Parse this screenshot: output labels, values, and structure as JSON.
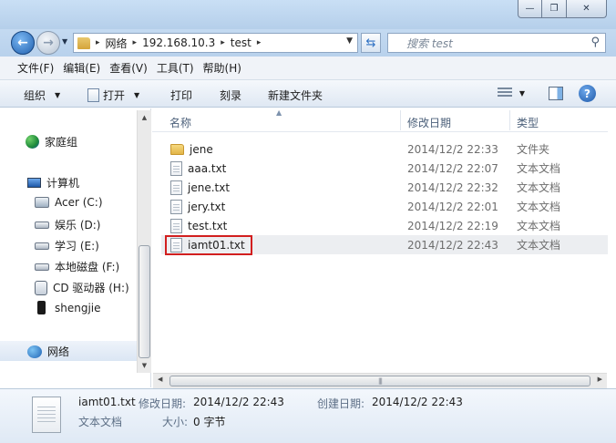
{
  "window": {
    "minimize_glyph": "—",
    "maximize_glyph": "❐",
    "close_glyph": "✕"
  },
  "address": {
    "segments": [
      "网络",
      "192.168.10.3",
      "test"
    ],
    "separator": "▸",
    "search_placeholder": "搜索 test"
  },
  "menu": [
    "文件(F)",
    "编辑(E)",
    "查看(V)",
    "工具(T)",
    "帮助(H)"
  ],
  "toolbar": {
    "organize": "组织",
    "open": "打开",
    "print": "打印",
    "burn": "刻录",
    "new_folder": "新建文件夹"
  },
  "nav": {
    "homegroup": "家庭组",
    "computer": "计算机",
    "drives": [
      {
        "label": "Acer (C:)",
        "icon": "windows-drive-icon"
      },
      {
        "label": "娱乐 (D:)",
        "icon": "drive-icon"
      },
      {
        "label": "学习 (E:)",
        "icon": "drive-icon"
      },
      {
        "label": "本地磁盘 (F:)",
        "icon": "drive-icon"
      },
      {
        "label": "CD 驱动器 (H:)",
        "icon": "cd-drive-icon"
      },
      {
        "label": "shengjie",
        "icon": "phone-icon"
      }
    ],
    "network": "网络"
  },
  "columns": {
    "name": "名称",
    "modified": "修改日期",
    "type": "类型"
  },
  "files": [
    {
      "name": "jene",
      "date": "2014/12/2 22:33",
      "type": "文件夹",
      "icon": "folder-icon"
    },
    {
      "name": "aaa.txt",
      "date": "2014/12/2 22:07",
      "type": "文本文档",
      "icon": "text-file-icon"
    },
    {
      "name": "jene.txt",
      "date": "2014/12/2 22:32",
      "type": "文本文档",
      "icon": "text-file-icon"
    },
    {
      "name": "jery.txt",
      "date": "2014/12/2 22:01",
      "type": "文本文档",
      "icon": "text-file-icon"
    },
    {
      "name": "test.txt",
      "date": "2014/12/2 22:19",
      "type": "文本文档",
      "icon": "text-file-icon"
    },
    {
      "name": "iamt01.txt",
      "date": "2014/12/2 22:43",
      "type": "文本文档",
      "icon": "text-file-icon",
      "selected": true
    }
  ],
  "details": {
    "filename": "iamt01.txt",
    "filetype": "文本文档",
    "modified_label": "修改日期:",
    "modified_value": "2014/12/2 22:43",
    "created_label": "创建日期:",
    "created_value": "2014/12/2 22:43",
    "size_label": "大小:",
    "size_value": "0 字节"
  },
  "colors": {
    "highlight_border": "#d21f1f",
    "accent": "#1d58a8"
  }
}
